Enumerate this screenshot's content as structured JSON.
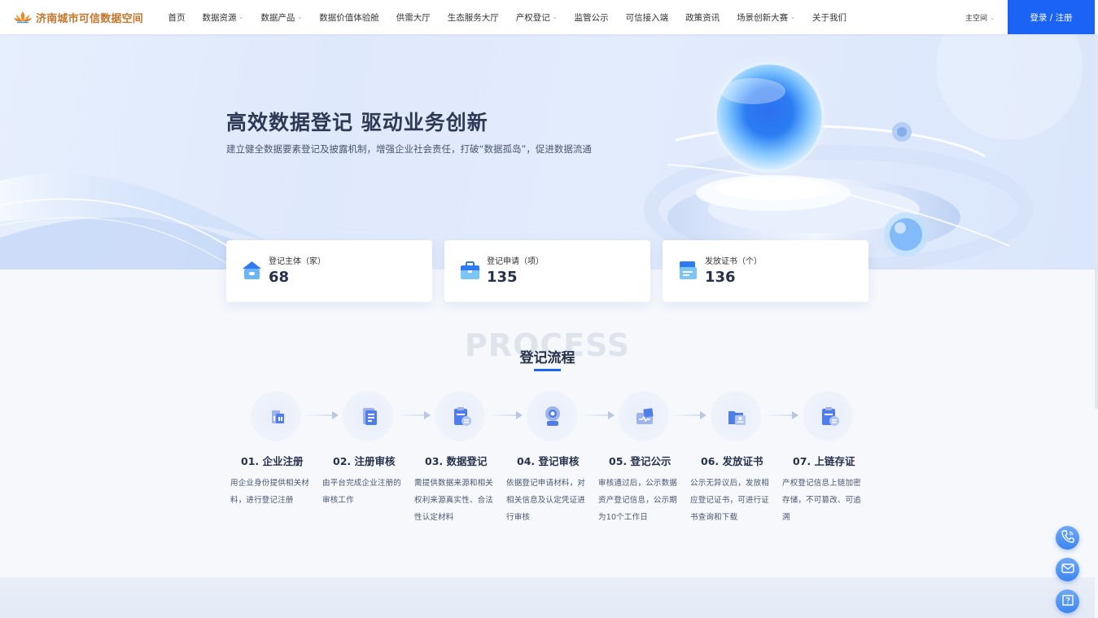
{
  "header": {
    "logo_text": "济南城市可信数据空间",
    "nav": [
      {
        "label": "首页",
        "dropdown": false
      },
      {
        "label": "数据资源",
        "dropdown": true
      },
      {
        "label": "数据产品",
        "dropdown": true
      },
      {
        "label": "数据价值体验舱",
        "dropdown": false
      },
      {
        "label": "供需大厅",
        "dropdown": false
      },
      {
        "label": "生态服务大厅",
        "dropdown": false
      },
      {
        "label": "产权登记",
        "dropdown": true
      },
      {
        "label": "监管公示",
        "dropdown": false
      },
      {
        "label": "可信接入端",
        "dropdown": false
      },
      {
        "label": "政策资讯",
        "dropdown": false
      },
      {
        "label": "场景创新大赛",
        "dropdown": true
      },
      {
        "label": "关于我们",
        "dropdown": false
      }
    ],
    "space_select": "主空间",
    "login_label": "登录 / 注册",
    "caret": "⌄"
  },
  "hero": {
    "title": "高效数据登记   驱动业务创新",
    "subtitle": "建立健全数据要素登记及披露机制，增强企业社会责任，打破“数据孤岛”，促进数据流通"
  },
  "stats": [
    {
      "label": "登记主体（家）",
      "value": "68",
      "icon": "house-icon"
    },
    {
      "label": "登记申请（项）",
      "value": "135",
      "icon": "briefcase-icon"
    },
    {
      "label": "发放证书（个）",
      "value": "136",
      "icon": "certificate-icon"
    }
  ],
  "process": {
    "bg_text": "PROCESS",
    "title": "登记流程",
    "steps": [
      {
        "title": "01. 企业注册",
        "desc": "用企业身份提供相关材料，进行登记注册",
        "icon": "building-icon"
      },
      {
        "title": "02. 注册审核",
        "desc": "由平台完成企业注册的审核工作",
        "icon": "document-list-icon"
      },
      {
        "title": "03. 数据登记",
        "desc": "需提供数据来源和相关权利来源真实性、合法性认定材料",
        "icon": "clipboard-icon"
      },
      {
        "title": "04. 登记审核",
        "desc": "依据登记申请材料，对相关信息及认定凭证进行审核",
        "icon": "camera-review-icon"
      },
      {
        "title": "05. 登记公示",
        "desc": "审核通过后，公示数据资产登记信息，公示期为10个工作日",
        "icon": "monitor-icon"
      },
      {
        "title": "06. 发放证书",
        "desc": "公示无异议后，发放相应登记证书，可进行证书查询和下载",
        "icon": "folder-certificate-icon"
      },
      {
        "title": "07. 上链存证",
        "desc": "产权登记信息上链加密存储，不可篡改、可追溯",
        "icon": "chain-record-icon"
      }
    ]
  },
  "floating": [
    {
      "name": "phone-icon"
    },
    {
      "name": "mail-icon"
    },
    {
      "name": "help-book-icon"
    }
  ],
  "colors": {
    "brand_blue": "#1a63f5",
    "logo_orange": "#c4762a",
    "text_dark": "#26324a"
  }
}
